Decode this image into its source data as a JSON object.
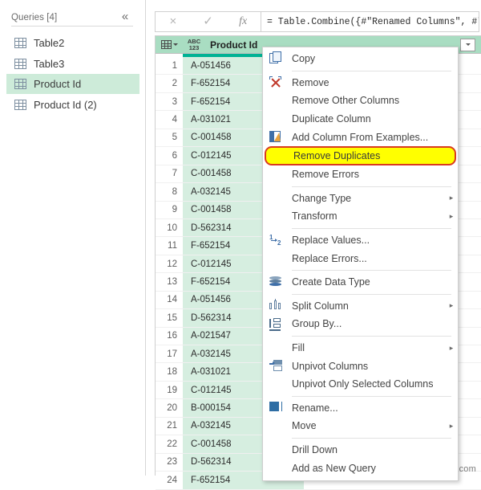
{
  "sidebar": {
    "title": "Queries [4]",
    "collapse_icon": "double-chevron-left-icon",
    "items": [
      {
        "label": "Table2",
        "selected": false
      },
      {
        "label": "Table3",
        "selected": false
      },
      {
        "label": "Product Id",
        "selected": true
      },
      {
        "label": "Product Id (2)",
        "selected": false
      }
    ]
  },
  "formula_bar": {
    "cancel_icon": "×",
    "confirm_icon": "✓",
    "fx_icon": "fx",
    "formula": "= Table.Combine({#\"Renamed Columns\", #\"Produ"
  },
  "grid": {
    "corner_icon": "table-select-icon",
    "type_indicator_top": "ABC",
    "type_indicator_bottom": "123",
    "column_header": "Product Id",
    "filter_icon": "chevron-down-icon",
    "accent_color": "#00b294",
    "header_color": "#a9ddc2",
    "cell_color": "#d6eee0",
    "rows": [
      {
        "n": "1",
        "value": "A-051456"
      },
      {
        "n": "2",
        "value": "F-652154"
      },
      {
        "n": "3",
        "value": "F-652154"
      },
      {
        "n": "4",
        "value": "A-031021"
      },
      {
        "n": "5",
        "value": "C-001458"
      },
      {
        "n": "6",
        "value": "C-012145"
      },
      {
        "n": "7",
        "value": "C-001458"
      },
      {
        "n": "8",
        "value": "A-032145"
      },
      {
        "n": "9",
        "value": "C-001458"
      },
      {
        "n": "10",
        "value": "D-562314"
      },
      {
        "n": "11",
        "value": "F-652154"
      },
      {
        "n": "12",
        "value": "C-012145"
      },
      {
        "n": "13",
        "value": "F-652154"
      },
      {
        "n": "14",
        "value": "A-051456"
      },
      {
        "n": "15",
        "value": "D-562314"
      },
      {
        "n": "16",
        "value": "A-021547"
      },
      {
        "n": "17",
        "value": "A-032145"
      },
      {
        "n": "18",
        "value": "A-031021"
      },
      {
        "n": "19",
        "value": "C-012145"
      },
      {
        "n": "20",
        "value": "B-000154"
      },
      {
        "n": "21",
        "value": "A-032145"
      },
      {
        "n": "22",
        "value": "C-001458"
      },
      {
        "n": "23",
        "value": "D-562314"
      },
      {
        "n": "24",
        "value": "F-652154"
      }
    ]
  },
  "context_menu": {
    "highlight_fill": "#ffff00",
    "highlight_border": "#d93b1e",
    "submenu_arrow": "▸",
    "items": [
      {
        "label": "Copy",
        "icon": "copy-icon",
        "submenu": false
      },
      {
        "label": "Remove",
        "icon": "remove-column-icon",
        "submenu": false
      },
      {
        "label": "Remove Other Columns",
        "icon": "",
        "submenu": false
      },
      {
        "label": "Duplicate Column",
        "icon": "",
        "submenu": false
      },
      {
        "label": "Add Column From Examples...",
        "icon": "add-column-from-examples-icon",
        "submenu": false
      },
      {
        "label": "Remove Duplicates",
        "icon": "",
        "submenu": false,
        "highlighted": true
      },
      {
        "label": "Remove Errors",
        "icon": "",
        "submenu": false
      },
      {
        "label": "Change Type",
        "icon": "",
        "submenu": true
      },
      {
        "label": "Transform",
        "icon": "",
        "submenu": true
      },
      {
        "label": "Replace Values...",
        "icon": "replace-values-icon",
        "submenu": false
      },
      {
        "label": "Replace Errors...",
        "icon": "",
        "submenu": false
      },
      {
        "label": "Create Data Type",
        "icon": "create-data-type-icon",
        "submenu": false
      },
      {
        "label": "Split Column",
        "icon": "split-column-icon",
        "submenu": true
      },
      {
        "label": "Group By...",
        "icon": "group-by-icon",
        "submenu": false
      },
      {
        "label": "Fill",
        "icon": "",
        "submenu": true
      },
      {
        "label": "Unpivot Columns",
        "icon": "unpivot-icon",
        "submenu": false
      },
      {
        "label": "Unpivot Only Selected Columns",
        "icon": "",
        "submenu": false
      },
      {
        "label": "Rename...",
        "icon": "rename-icon",
        "submenu": false
      },
      {
        "label": "Move",
        "icon": "",
        "submenu": true
      },
      {
        "label": "Drill Down",
        "icon": "",
        "submenu": false
      },
      {
        "label": "Add as New Query",
        "icon": "",
        "submenu": false
      }
    ]
  },
  "watermark": "wsxdn.com"
}
